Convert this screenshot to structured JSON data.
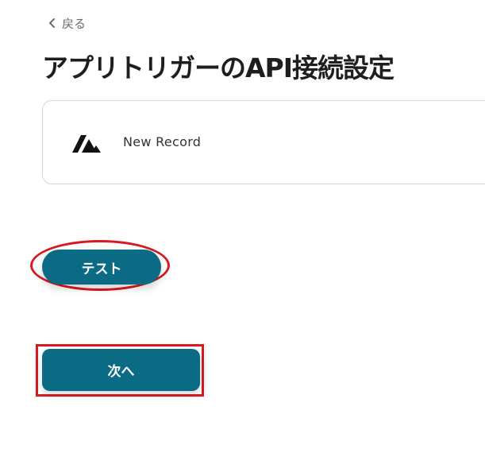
{
  "nav": {
    "back_label": "戻る",
    "back_icon": "chevron-left-icon"
  },
  "page": {
    "title": "アプリトリガーのAPI接続設定"
  },
  "trigger": {
    "app_icon": "app-logo-icon",
    "label": "New Record"
  },
  "actions": {
    "test_label": "テスト",
    "next_label": "次へ"
  },
  "colors": {
    "button": "#0c6b84",
    "highlight": "#d71a20",
    "title_text": "#1e1e1e",
    "back_text": "#6b6b6b",
    "card_border": "#d6d6d6"
  }
}
